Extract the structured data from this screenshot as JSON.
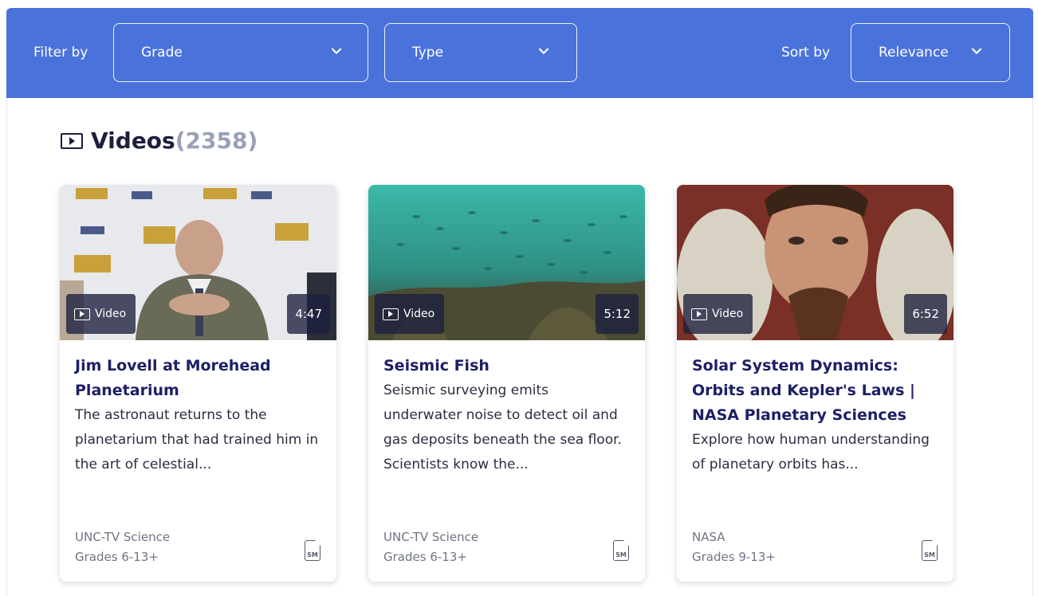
{
  "filterbar": {
    "filter_label": "Filter by",
    "grade_label": "Grade",
    "type_label": "Type",
    "sort_label": "Sort by",
    "sort_value": "Relevance"
  },
  "section": {
    "title": "Videos",
    "count": "(2358)"
  },
  "colors": {
    "filterbar_bg": "#4a72db",
    "title_color": "#1c2065",
    "count_color": "#9aa0b8"
  },
  "cards": [
    {
      "badge": "Video",
      "duration": "4:47",
      "title": "Jim Lovell at Morehead Planetarium",
      "description": "The astronaut returns to the planetarium that had trained him in the art of celestial...",
      "source": "UNC-TV Science",
      "grades": "Grades 6-13+",
      "icon": "sm-standard-icon",
      "icon_text": "SM"
    },
    {
      "badge": "Video",
      "duration": "5:12",
      "title": "Seismic Fish",
      "description": "Seismic surveying emits underwater noise to detect oil and gas deposits beneath the sea floor. Scientists know the...",
      "source": "UNC-TV Science",
      "grades": "Grades 6-13+",
      "icon": "sm-standard-icon",
      "icon_text": "SM"
    },
    {
      "badge": "Video",
      "duration": "6:52",
      "title": "Solar System Dynamics: Orbits and Kepler's Laws | NASA Planetary Sciences",
      "description": "Explore how human understanding of planetary orbits has...",
      "source": "NASA",
      "grades": "Grades 9-13+",
      "icon": "sm-standard-icon",
      "icon_text": "SM"
    }
  ]
}
